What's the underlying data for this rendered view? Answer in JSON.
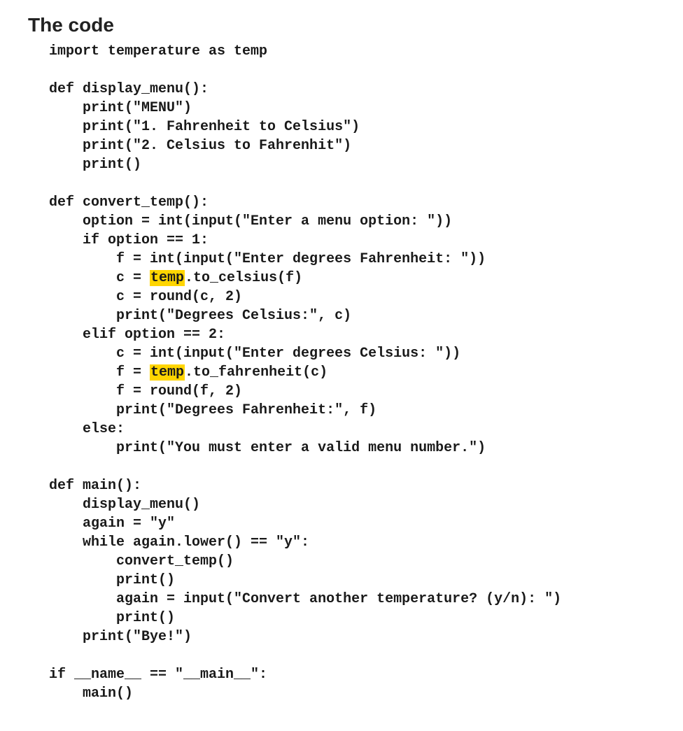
{
  "heading": "The code",
  "code": {
    "lines": [
      [
        {
          "t": "import temperature as temp"
        }
      ],
      [],
      [
        {
          "t": "def display_menu():"
        }
      ],
      [
        {
          "t": "    print(\"MENU\")"
        }
      ],
      [
        {
          "t": "    print(\"1. Fahrenheit to Celsius\")"
        }
      ],
      [
        {
          "t": "    print(\"2. Celsius to Fahrenhit\")"
        }
      ],
      [
        {
          "t": "    print()"
        }
      ],
      [],
      [
        {
          "t": "def convert_temp():"
        }
      ],
      [
        {
          "t": "    option = int(input(\"Enter a menu option: \"))"
        }
      ],
      [
        {
          "t": "    if option == 1:"
        }
      ],
      [
        {
          "t": "        f = int(input(\"Enter degrees Fahrenheit: \"))"
        }
      ],
      [
        {
          "t": "        c = "
        },
        {
          "t": "temp",
          "hl": true
        },
        {
          "t": ".to_celsius(f)"
        }
      ],
      [
        {
          "t": "        c = round(c, 2)"
        }
      ],
      [
        {
          "t": "        print(\"Degrees Celsius:\", c)"
        }
      ],
      [
        {
          "t": "    elif option == 2:"
        }
      ],
      [
        {
          "t": "        c = int(input(\"Enter degrees Celsius: \"))"
        }
      ],
      [
        {
          "t": "        f = "
        },
        {
          "t": "temp",
          "hl": true
        },
        {
          "t": ".to_fahrenheit(c)"
        }
      ],
      [
        {
          "t": "        f = round(f, 2)"
        }
      ],
      [
        {
          "t": "        print(\"Degrees Fahrenheit:\", f)"
        }
      ],
      [
        {
          "t": "    else:"
        }
      ],
      [
        {
          "t": "        print(\"You must enter a valid menu number.\")"
        }
      ],
      [],
      [
        {
          "t": "def main():"
        }
      ],
      [
        {
          "t": "    display_menu()"
        }
      ],
      [
        {
          "t": "    again = \"y\""
        }
      ],
      [
        {
          "t": "    while again.lower() == \"y\":"
        }
      ],
      [
        {
          "t": "        convert_temp()"
        }
      ],
      [
        {
          "t": "        print()"
        }
      ],
      [
        {
          "t": "        again = input(\"Convert another temperature? (y/n): \")"
        }
      ],
      [
        {
          "t": "        print()"
        }
      ],
      [
        {
          "t": "    print(\"Bye!\")"
        }
      ],
      [],
      [
        {
          "t": "if __name__ == \"__main__\":"
        }
      ],
      [
        {
          "t": "    main()"
        }
      ]
    ]
  }
}
